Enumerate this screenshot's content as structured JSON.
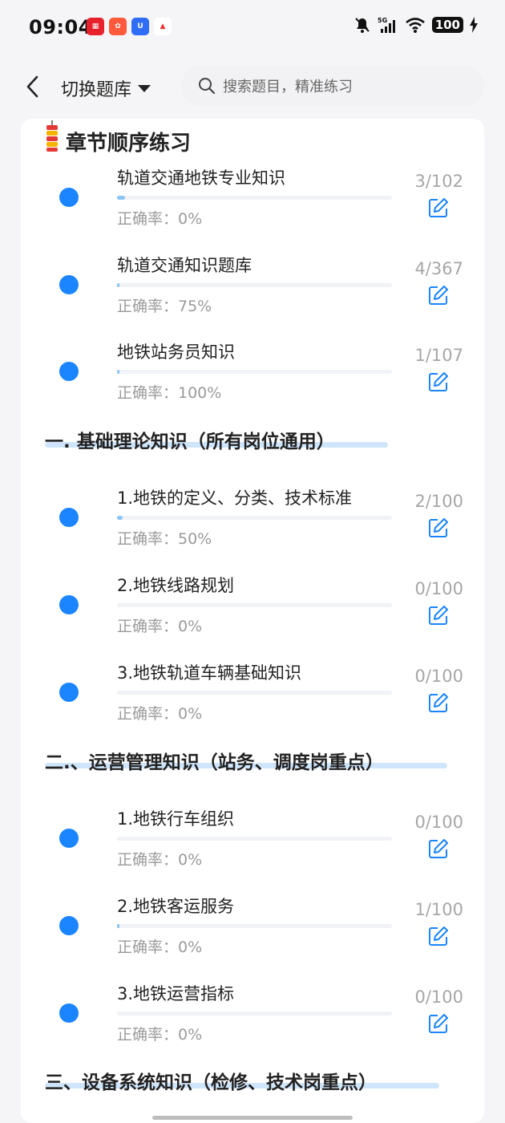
{
  "status": {
    "time": "09:04",
    "network": "5G",
    "battery": "100"
  },
  "header": {
    "switch_label": "切换题库",
    "search_placeholder": "搜索题目，精准练习"
  },
  "chapter": {
    "title": "章节顺序练习",
    "items": [
      {
        "name": "轨道交通地铁专业知识",
        "rate": "正确率：0%",
        "count": "3/102",
        "progress": 0.03
      },
      {
        "name": "轨道交通知识题库",
        "rate": "正确率：75%",
        "count": "4/367",
        "progress": 0.01
      },
      {
        "name": "地铁站务员知识",
        "rate": "正确率：100%",
        "count": "1/107",
        "progress": 0.01
      }
    ]
  },
  "sections": [
    {
      "title": "一. 基础理论知识（所有岗位通用）",
      "items": [
        {
          "name": "1.地铁的定义、分类、技术标准",
          "rate": "正确率：50%",
          "count": "2/100",
          "progress": 0.02
        },
        {
          "name": "2.地铁线路规划",
          "rate": "正确率：0%",
          "count": "0/100",
          "progress": 0
        },
        {
          "name": "3.地铁轨道车辆基础知识",
          "rate": "正确率：0%",
          "count": "0/100",
          "progress": 0
        }
      ]
    },
    {
      "title": "二.、运营管理知识（站务、调度岗重点）",
      "items": [
        {
          "name": "1.地铁行车组织",
          "rate": "正确率：0%",
          "count": "0/100",
          "progress": 0
        },
        {
          "name": "2.地铁客运服务",
          "rate": "正确率：0%",
          "count": "1/100",
          "progress": 0.01
        },
        {
          "name": "3.地铁运营指标",
          "rate": "正确率：0%",
          "count": "0/100",
          "progress": 0
        }
      ]
    },
    {
      "title": "三、设备系统知识（检修、技术岗重点）",
      "items": []
    }
  ],
  "colors": {
    "accent": "#1a85ff",
    "progress": "#8cc4f3",
    "underline": "#cfe5fb"
  }
}
